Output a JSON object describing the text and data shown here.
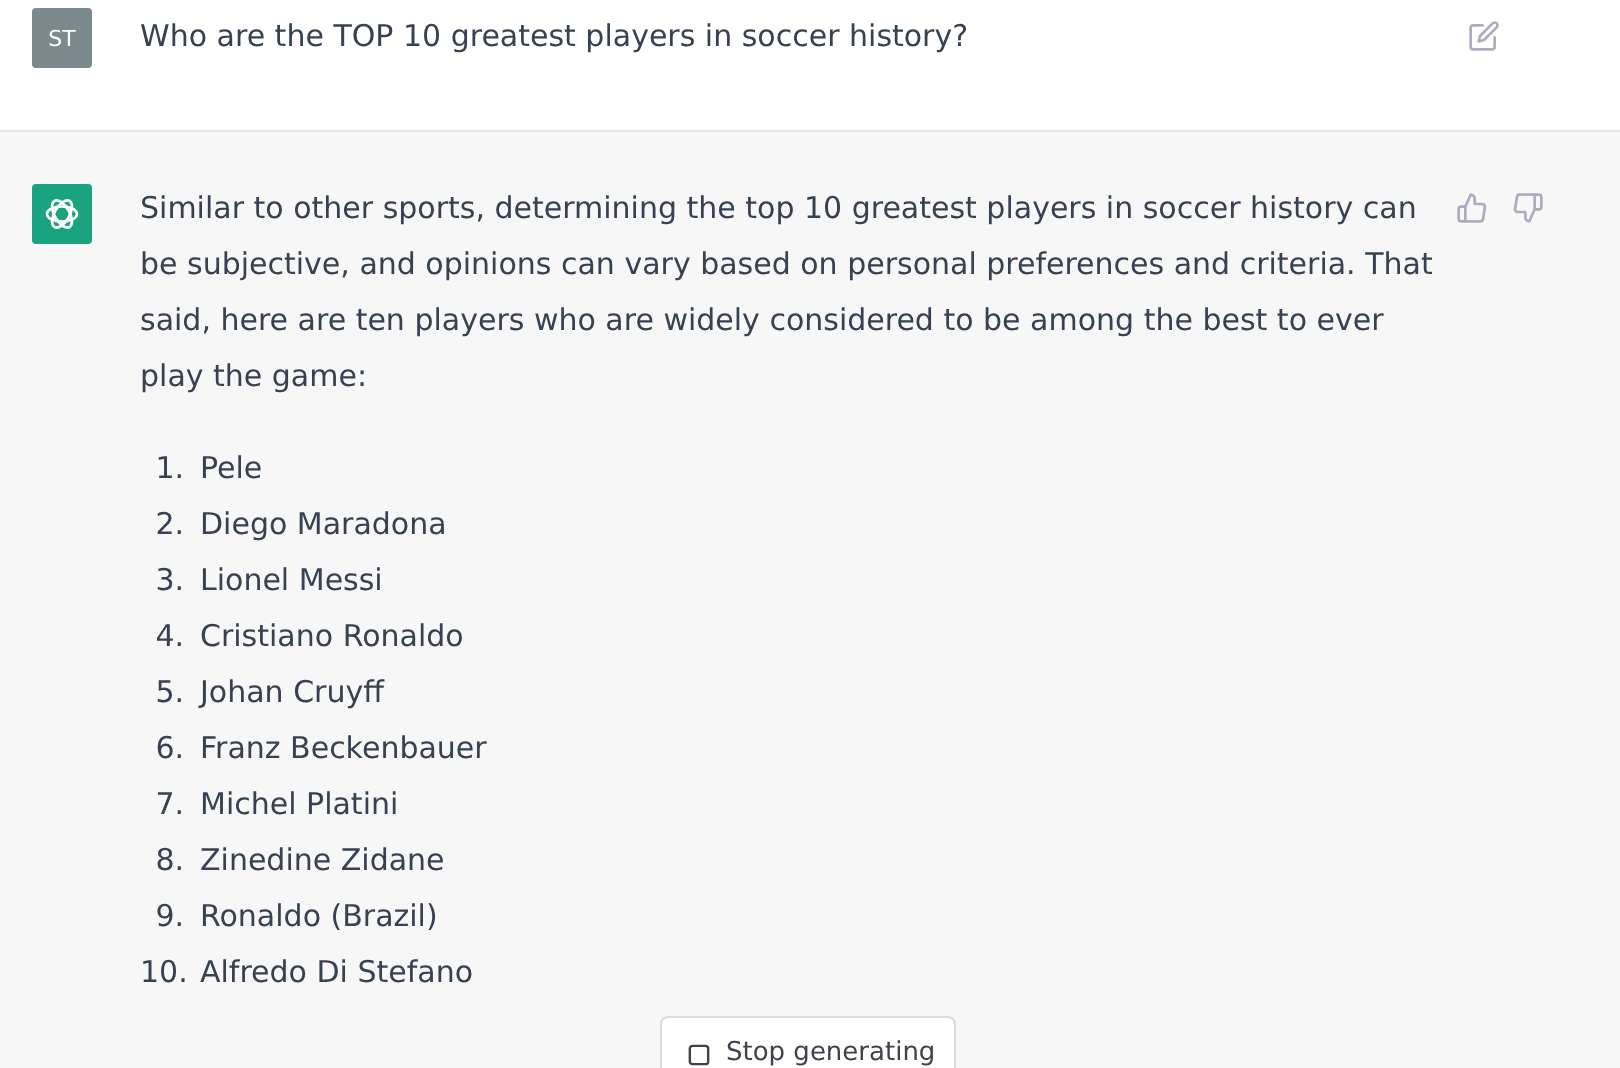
{
  "user_message": {
    "avatar": "ST",
    "text": "Who are the TOP 10 greatest players in soccer history?"
  },
  "assistant_message": {
    "intro": "Similar to other sports, determining the top 10 greatest players in soccer history can be subjective, and opinions can vary based on personal preferences and criteria. That said, here are ten players who are widely considered to be among the best to ever play the game:",
    "list": [
      {
        "number": "1.",
        "name": "Pele"
      },
      {
        "number": "2.",
        "name": "Diego Maradona"
      },
      {
        "number": "3.",
        "name": "Lionel Messi"
      },
      {
        "number": "4.",
        "name": "Cristiano Ronaldo"
      },
      {
        "number": "5.",
        "name": "Johan Cruyff"
      },
      {
        "number": "6.",
        "name": "Franz Beckenbauer"
      },
      {
        "number": "7.",
        "name": "Michel Platini"
      },
      {
        "number": "8.",
        "name": "Zinedine Zidane"
      },
      {
        "number": "9.",
        "name": "Ronaldo (Brazil)"
      },
      {
        "number": "10.",
        "name": "Alfredo Di Stefano"
      }
    ]
  },
  "stop_button": {
    "label": "Stop generating"
  }
}
